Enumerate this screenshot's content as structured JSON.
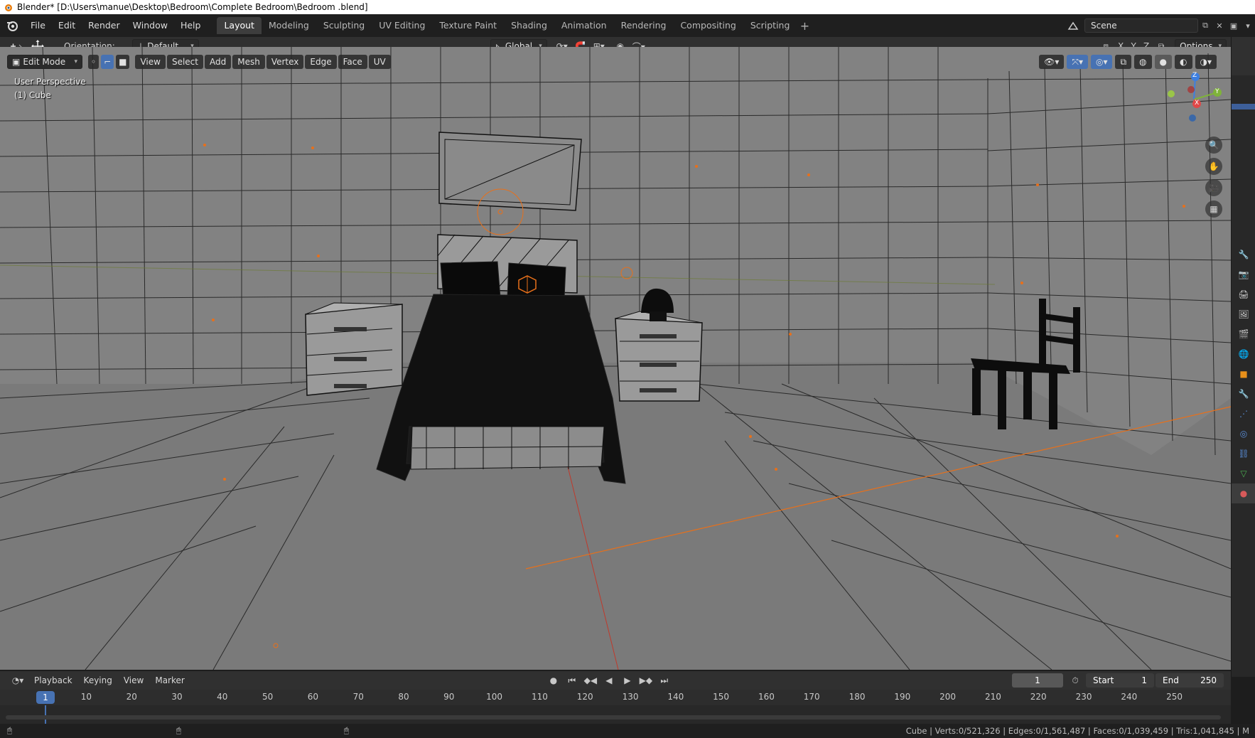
{
  "window": {
    "title": "Blender* [D:\\Users\\manue\\Desktop\\Bedroom\\Complete Bedroom\\Bedroom .blend]"
  },
  "menus": [
    "File",
    "Edit",
    "Render",
    "Window",
    "Help"
  ],
  "workspaces": [
    {
      "label": "Layout",
      "active": true
    },
    {
      "label": "Modeling"
    },
    {
      "label": "Sculpting"
    },
    {
      "label": "UV Editing"
    },
    {
      "label": "Texture Paint"
    },
    {
      "label": "Shading"
    },
    {
      "label": "Animation"
    },
    {
      "label": "Rendering"
    },
    {
      "label": "Compositing"
    },
    {
      "label": "Scripting"
    }
  ],
  "scene": {
    "name": "Scene"
  },
  "toolbar": {
    "orientation_label": "Orientation:",
    "orientation_value": "Default",
    "transform_orientation": "Global",
    "options_label": "Options",
    "axis_x": "X",
    "axis_y": "Y",
    "axis_z": "Z"
  },
  "viewport_header": {
    "mode": "Edit Mode",
    "menus": [
      "View",
      "Select",
      "Add",
      "Mesh",
      "Vertex",
      "Edge",
      "Face",
      "UV"
    ]
  },
  "viewport": {
    "perspective": "User Perspective",
    "object": "(1) Cube",
    "gizmo": {
      "z": "Z",
      "y": "Y",
      "x": "X"
    }
  },
  "timeline": {
    "menus": [
      "Playback",
      "Keying",
      "View",
      "Marker"
    ],
    "current_frame": "1",
    "start_label": "Start",
    "start_value": "1",
    "end_label": "End",
    "end_value": "250",
    "ticks": [
      "10",
      "20",
      "30",
      "40",
      "50",
      "60",
      "70",
      "80",
      "90",
      "100",
      "110",
      "120",
      "130",
      "140",
      "150",
      "160",
      "170",
      "180",
      "190",
      "200",
      "210",
      "220",
      "230",
      "240",
      "250"
    ],
    "marker_frame": "1"
  },
  "status": {
    "stats": "Cube | Verts:0/521,326 | Edges:0/1,561,487 | Faces:0/1,039,459 | Tris:1,041,845 | M"
  },
  "colors": {
    "accent": "#4772b3",
    "active_tab": "#3d3d3d",
    "viewport_bg": "#7d7d7d",
    "origin_orange": "#e8701a"
  }
}
